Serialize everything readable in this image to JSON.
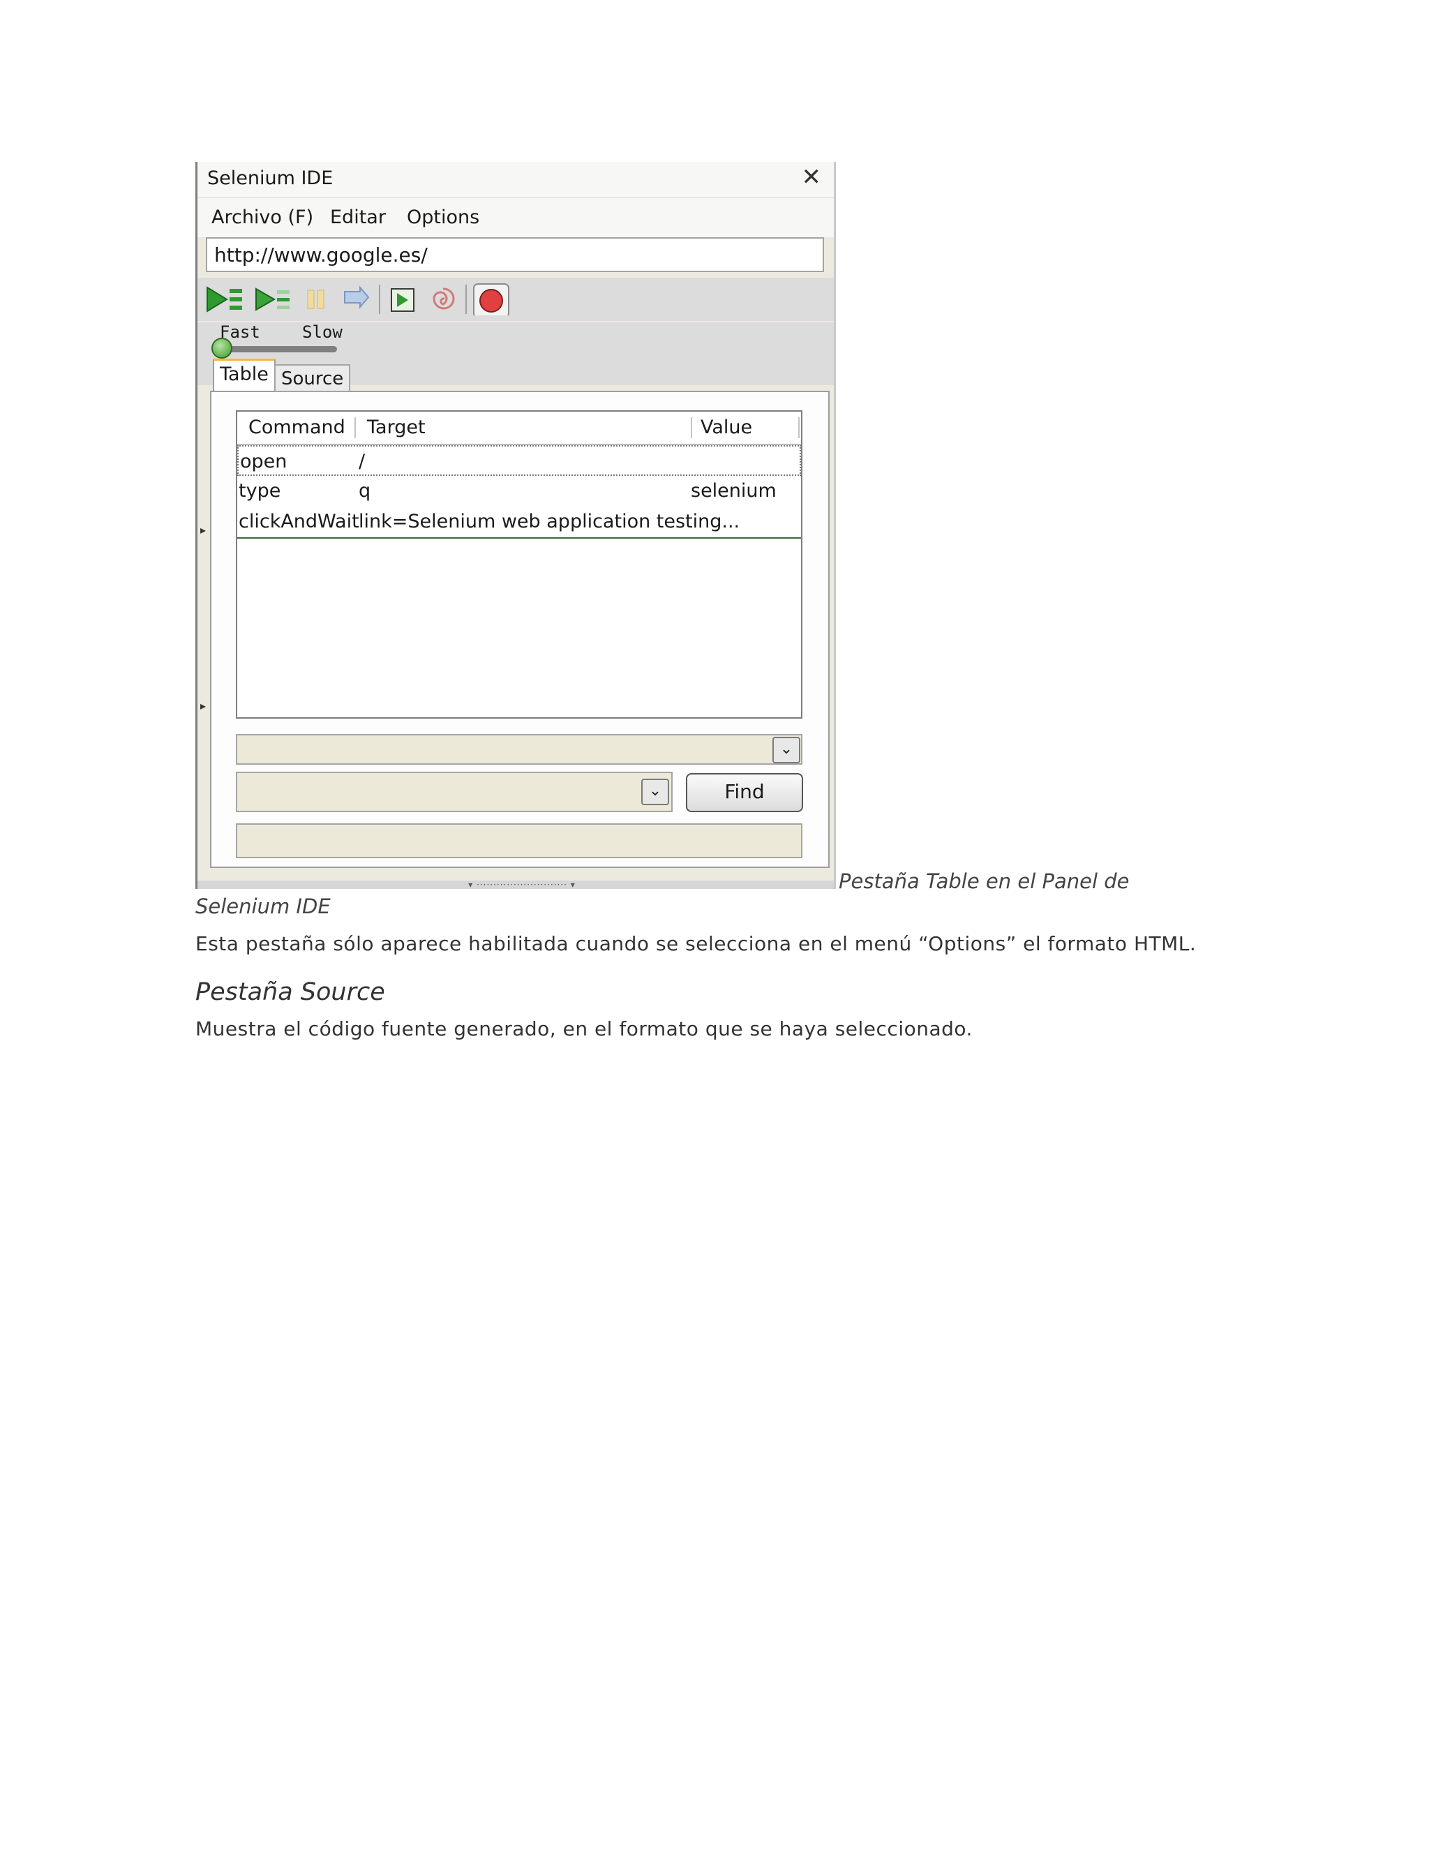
{
  "window": {
    "title": "Selenium IDE",
    "close_glyph": "✕",
    "menu": [
      {
        "label": "Archivo (F)"
      },
      {
        "label": "Editar"
      },
      {
        "label": "Options"
      }
    ],
    "url": "http://www.google.es/",
    "toolbar_icons": [
      "play-all-icon",
      "play-current-icon",
      "pause-icon",
      "step-icon",
      "test-runner-icon",
      "rollup-icon",
      "record-icon"
    ],
    "speed": {
      "fast_label": "Fast",
      "slow_label": "Slow",
      "level": 0
    },
    "tabs": [
      {
        "label": "Table",
        "active": true
      },
      {
        "label": "Source",
        "active": false
      }
    ],
    "table": {
      "headers": [
        "Command",
        "Target",
        "Value"
      ],
      "rows": [
        {
          "command": "open",
          "target": "/",
          "value": ""
        },
        {
          "command": "type",
          "target": "q",
          "value": "selenium"
        },
        {
          "command": "clickAndWait",
          "target": "link=Selenium web application testing...",
          "value": ""
        }
      ]
    },
    "find_button": "Find",
    "record_color": "#e04040",
    "play_color": "#2f9a2f"
  },
  "doc": {
    "caption_line1": "Pestaña Table en el Panel de",
    "caption_line2": "Selenium IDE",
    "paragraph1": "Esta pestaña sólo aparece habilitada cuando se selecciona en el menú “Options” el formato HTML.",
    "heading": "Pestaña Source",
    "paragraph2": "Muestra el código fuente generado, en el formato que se haya seleccionado."
  }
}
